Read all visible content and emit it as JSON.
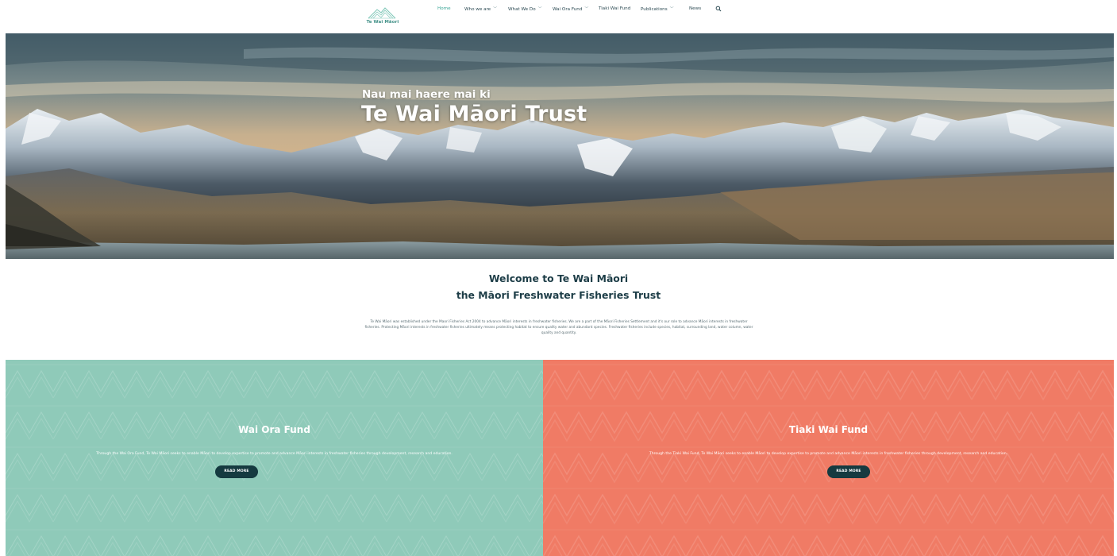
{
  "header": {
    "logo_text": "Te Wai Māori",
    "nav": [
      {
        "label": "Home",
        "has_dropdown": false,
        "active": true
      },
      {
        "label": "Who we are",
        "has_dropdown": true,
        "active": false
      },
      {
        "label": "What We Do",
        "has_dropdown": true,
        "active": false
      },
      {
        "label": "Wai Ora Fund",
        "has_dropdown": true,
        "active": false
      },
      {
        "label": "Tiaki Wai Fund",
        "has_dropdown": false,
        "active": false
      },
      {
        "label": "Publications",
        "has_dropdown": true,
        "active": false
      },
      {
        "label": "News",
        "has_dropdown": false,
        "active": false
      }
    ],
    "search_icon": "search-icon",
    "chevron_icon": "chevron-down-icon"
  },
  "hero": {
    "subtitle": "Nau mai haere mai ki",
    "title": "Te Wai Māori Trust"
  },
  "welcome": {
    "heading_line1": "Welcome to Te Wai Māori",
    "heading_line2": "the Māori Freshwater Fisheries Trust",
    "body": "Te Wai Māori was established under the Maori Fisheries Act 2004 to advance Māori interests in freshwater fisheries. We are a part of the Māori Fisheries Settlement and it's our role to advance Māori interests in freshwater fisheries. Protecting Māori interests in freshwater fisheries ultimately means protecting habitat to ensure quality water and abundant species. Freshwater fisheries include species, habitat, surrounding land, water column, water quality and quantity."
  },
  "funds": {
    "wai_ora": {
      "title": "Wai Ora Fund",
      "description": "Through the Wai Ora Fund, Te Wai Māori seeks to enable Māori to develop expertise to promote and advance Māori interests in freshwater fisheries through development, research and education.",
      "button": "READ MORE",
      "color": "#8fcab9"
    },
    "tiaki_wai": {
      "title": "Tiaki Wai Fund",
      "description": "Through the Tiaki Wai Fund, Te Wai Māori seeks to enable Māori to develop expertise to promote and advance Māori interests in freshwater fisheries through development, research and education.",
      "button": "READ MORE",
      "color": "#f07b65"
    }
  },
  "colors": {
    "accent": "#39a596",
    "dark": "#153a40",
    "heading": "#1d3d47"
  }
}
